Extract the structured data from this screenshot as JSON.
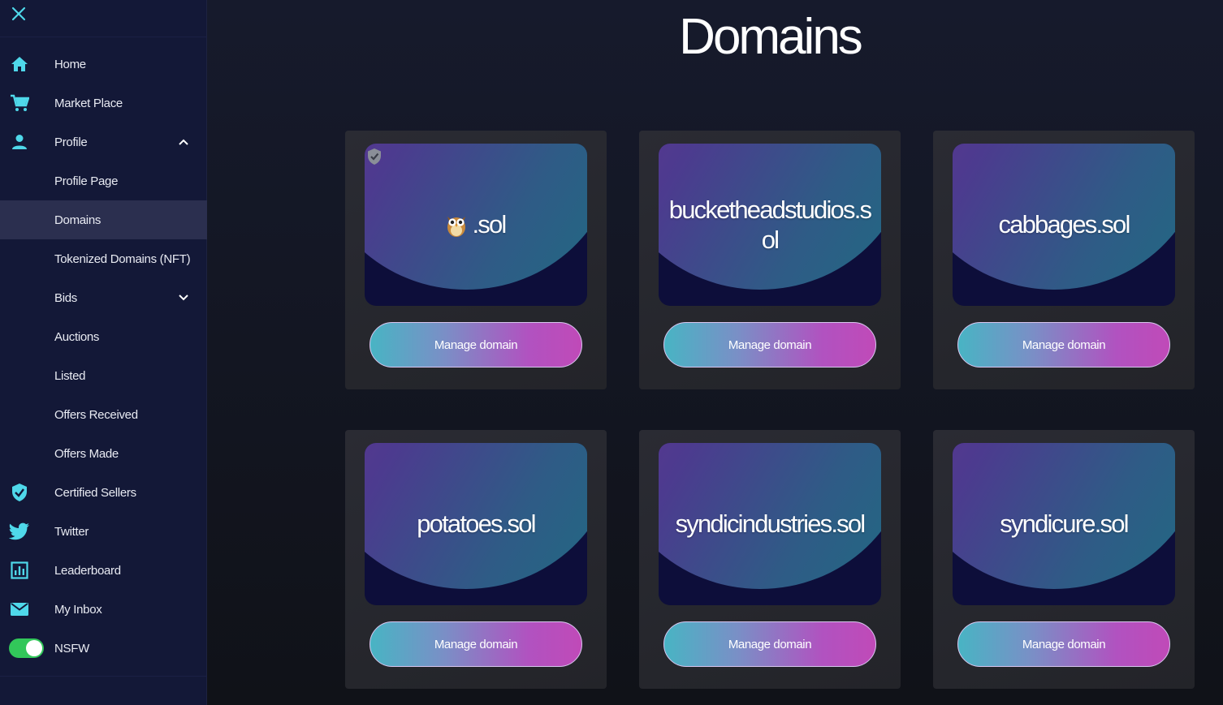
{
  "sidebar": {
    "close_icon": "close-icon",
    "items": [
      {
        "label": "Home",
        "icon": "home-icon"
      },
      {
        "label": "Market Place",
        "icon": "cart-icon"
      },
      {
        "label": "Profile",
        "icon": "person-icon",
        "expanded": true
      },
      {
        "label": "Profile Page"
      },
      {
        "label": "Domains",
        "active": true
      },
      {
        "label": "Tokenized Domains (NFT)"
      },
      {
        "label": "Bids",
        "expanded": false
      },
      {
        "label": "Auctions"
      },
      {
        "label": "Listed"
      },
      {
        "label": "Offers Received"
      },
      {
        "label": "Offers Made"
      },
      {
        "label": "Certified Sellers",
        "icon": "shield-check-icon"
      },
      {
        "label": "Twitter",
        "icon": "twitter-icon"
      },
      {
        "label": "Leaderboard",
        "icon": "chart-icon"
      },
      {
        "label": "My Inbox",
        "icon": "mail-icon"
      },
      {
        "label": "NSFW",
        "toggle_on": true
      }
    ]
  },
  "main": {
    "title": "Domains",
    "manage_label": "Manage domain",
    "cards": [
      {
        "name": ".sol",
        "verified": true,
        "emoji_icon": "owl-icon"
      },
      {
        "name": "bucketheadstudios.sol"
      },
      {
        "name": "cabbages.sol"
      },
      {
        "name": "potatoes.sol"
      },
      {
        "name": "syndicindustries.sol"
      },
      {
        "name": "syndicure.sol"
      }
    ]
  },
  "colors": {
    "sidebar_bg": "#131837",
    "accent_cyan": "#4fd8ea",
    "toggle_green": "#32c75a",
    "button_gradient_start": "#48b4c4",
    "button_gradient_end": "#c04ab8"
  }
}
